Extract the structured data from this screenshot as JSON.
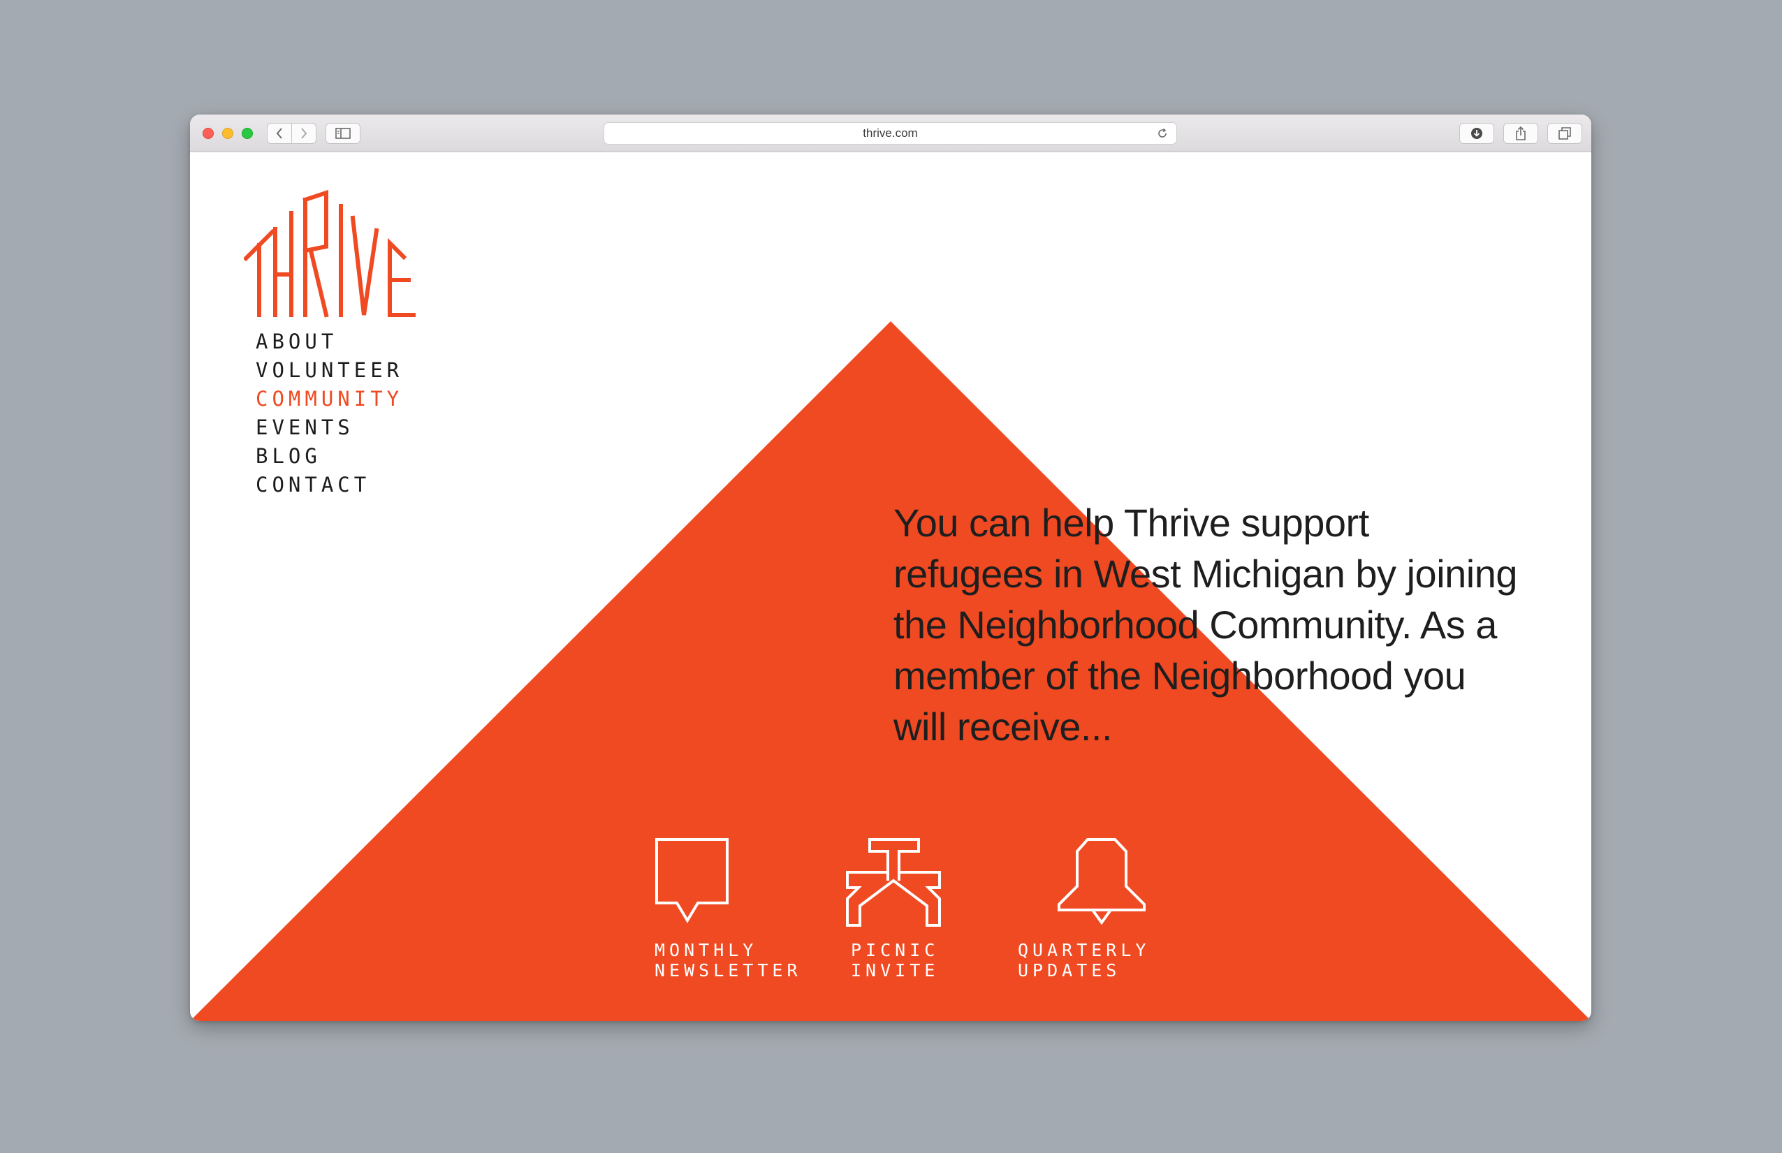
{
  "browser": {
    "url": "thrive.com",
    "icons": [
      "back-arrow-icon",
      "forward-arrow-icon",
      "sidebar-icon",
      "reload-icon",
      "download-icon",
      "share-icon",
      "tabs-icon"
    ]
  },
  "brand": {
    "logo_text": "THRIVE",
    "accent_color": "#f04a23",
    "text_color": "#1e1e1e"
  },
  "nav": {
    "items": [
      {
        "label": "ABOUT",
        "active": false
      },
      {
        "label": "VOLUNTEER",
        "active": false
      },
      {
        "label": "COMMUNITY",
        "active": true
      },
      {
        "label": "EVENTS",
        "active": false
      },
      {
        "label": "BLOG",
        "active": false
      },
      {
        "label": "CONTACT",
        "active": false
      }
    ]
  },
  "main": {
    "intro": "You can help Thrive support refugees in West Michigan by joining the Neighborhood Community. As a member of the Neighborhood you will receive...",
    "benefits": [
      {
        "label": "MONTHLY\nNEWSLETTER",
        "icon": "speech-bubble-icon"
      },
      {
        "label": "PICNIC\nINVITE",
        "icon": "picnic-table-icon"
      },
      {
        "label": "QUARTERLY\nUPDATES",
        "icon": "bell-icon"
      }
    ]
  }
}
